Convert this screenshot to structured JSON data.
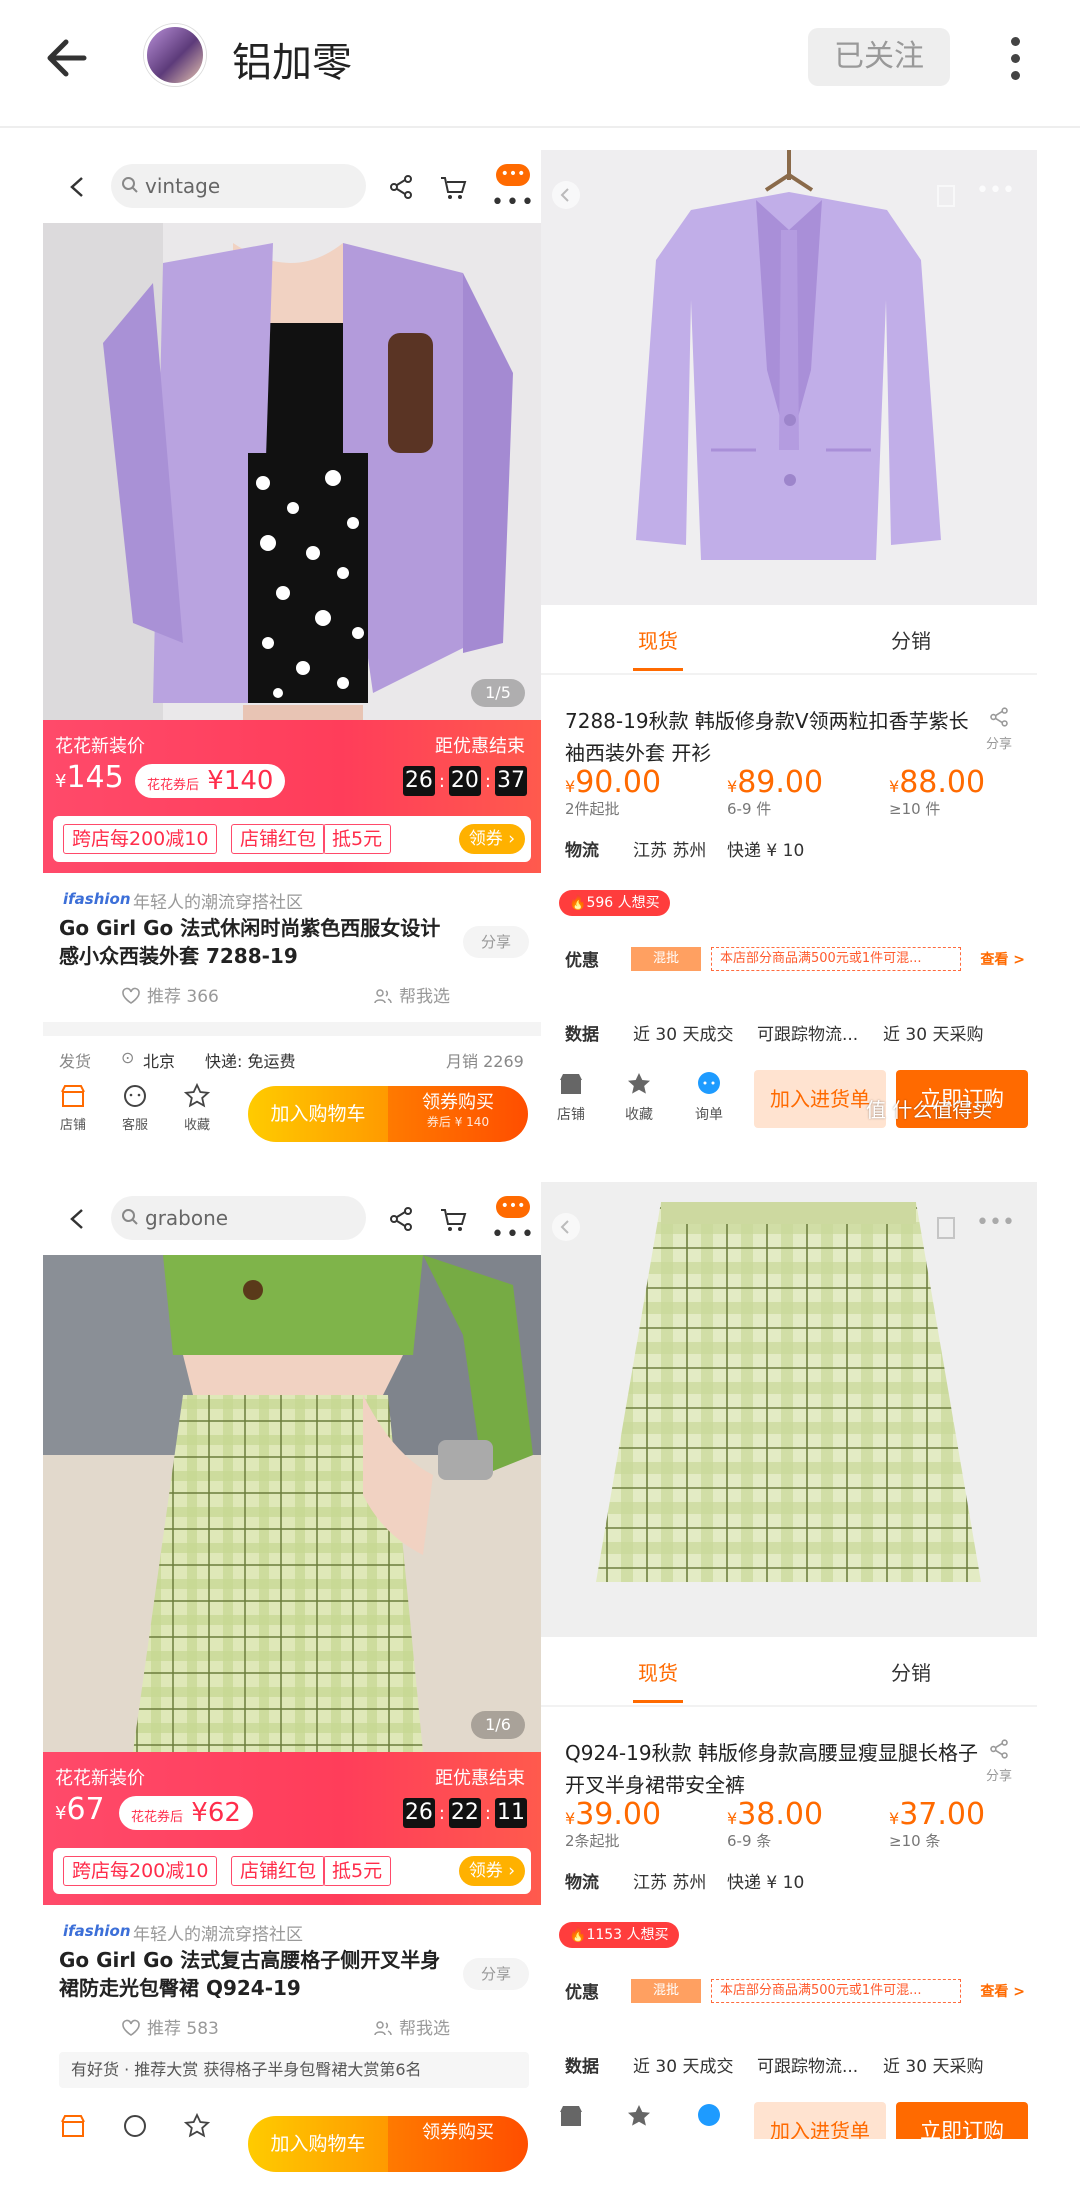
{
  "header": {
    "username": "铝加零",
    "follow_label": "已关注"
  },
  "cards": [
    {
      "search": "vintage",
      "msg_count": "•••",
      "pager": "1/5",
      "promo": {
        "tag": "花花新装价",
        "price": "145",
        "currency": "¥",
        "coupon_label": "花花券后",
        "coupon_price": "¥140",
        "end_label": "距优惠结束",
        "timer": [
          "26",
          "20",
          "37"
        ],
        "tags": [
          "跨店每200减10",
          "店铺红包",
          "抵5元"
        ],
        "receive": "领券 ›"
      },
      "brand": "ifashion",
      "brand_sub": "年轻人的潮流穿搭社区",
      "title": "Go Girl Go 法式休闲时尚紫色西服女设计感小众西装外套 7288-19",
      "share": "分享",
      "recommend": "推荐 366",
      "help": "帮我选",
      "ship": {
        "label": "发货",
        "city": "北京",
        "express": "快递: 免运费",
        "sales": "月销 2269"
      },
      "bottom": {
        "shop": "店铺",
        "service": "客服",
        "collect": "收藏",
        "cart": "加入购物车",
        "buy": "领券购买",
        "buy_sub": "券后 ¥ 140"
      },
      "right": {
        "tab_spot": "现货",
        "tab_dist": "分销",
        "title": "7288-19秋款 韩版修身款V领两粒扣香芋紫长袖西装外套 开衫",
        "share": "分享",
        "tiers": [
          {
            "p": "90.00",
            "q": "2件起批"
          },
          {
            "p": "89.00",
            "q": "6-9 件"
          },
          {
            "p": "88.00",
            "q": "≥10 件"
          }
        ],
        "logistics_label": "物流",
        "origin": "江苏 苏州",
        "express": "快递 ¥ 10",
        "hot": "596 人想买",
        "discount_label": "优惠",
        "mix": "混批",
        "coupon": "本店部分商品满500元或1件可混...",
        "look": "查看 >",
        "data_label": "数据",
        "d1": "近 30 天成交",
        "d2": "可跟踪物流...",
        "d3": "近 30 天采购",
        "shop": "店铺",
        "collect": "收藏",
        "ask": "询单",
        "add": "加入进货单",
        "order": "立即订购",
        "watermark": "值 什么值得买"
      }
    },
    {
      "search": "grabone",
      "msg_count": "•••",
      "pager": "1/6",
      "promo": {
        "tag": "花花新装价",
        "price": "67",
        "currency": "¥",
        "coupon_label": "花花券后",
        "coupon_price": "¥62",
        "end_label": "距优惠结束",
        "timer": [
          "26",
          "22",
          "11"
        ],
        "tags": [
          "跨店每200减10",
          "店铺红包",
          "抵5元"
        ],
        "receive": "领券 ›"
      },
      "brand": "ifashion",
      "brand_sub": "年轻人的潮流穿搭社区",
      "title": "Go Girl Go 法式复古高腰格子侧开叉半身裙防走光包臀裙 Q924-19",
      "share": "分享",
      "recommend": "推荐 583",
      "help": "帮我选",
      "rank": "有好货 · 推荐大赏  获得格子半身包臀裙大赏第6名",
      "bottom": {
        "cart": "加入购物车",
        "buy": "领券购买"
      },
      "right": {
        "tab_spot": "现货",
        "tab_dist": "分销",
        "title": "Q924-19秋款 韩版修身款高腰显瘦显腿长格子开叉半身裙带安全裤",
        "share": "分享",
        "tiers": [
          {
            "p": "39.00",
            "q": "2条起批"
          },
          {
            "p": "38.00",
            "q": "6-9 条"
          },
          {
            "p": "37.00",
            "q": "≥10 条"
          }
        ],
        "logistics_label": "物流",
        "origin": "江苏 苏州",
        "express": "快递 ¥ 10",
        "hot": "1153 人想买",
        "discount_label": "优惠",
        "mix": "混批",
        "coupon": "本店部分商品满500元或1件可混...",
        "look": "查看 >",
        "data_label": "数据",
        "d1": "近 30 天成交",
        "d2": "可跟踪物流...",
        "d3": "近 30 天采购",
        "add": "加入进货单",
        "order": "立即订购"
      }
    }
  ],
  "colors": {
    "accent": "#ff6a00",
    "promo": "#ff3d5a",
    "lavender": "#b9a3e0",
    "plaid": "#c9d99a"
  }
}
